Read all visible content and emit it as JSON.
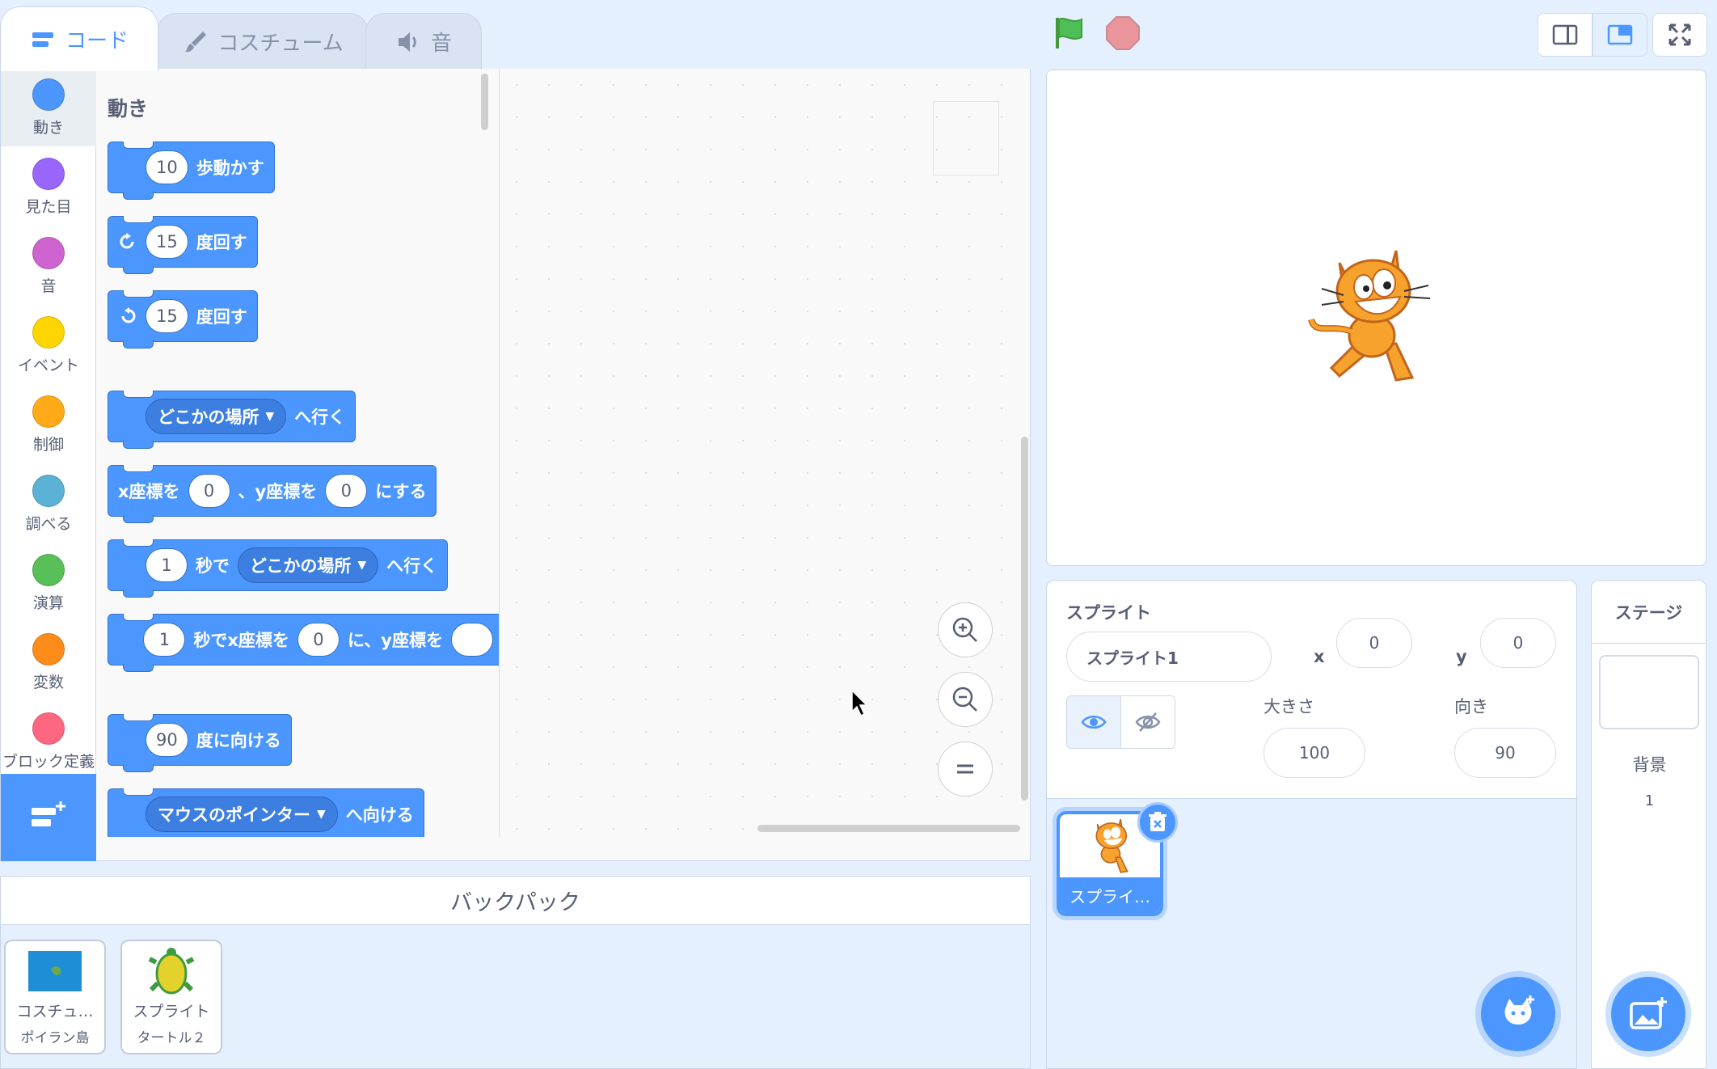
{
  "tabs": [
    {
      "label": "コード",
      "icon": "code-icon"
    },
    {
      "label": "コスチューム",
      "icon": "brush-icon"
    },
    {
      "label": "音",
      "icon": "speaker-icon"
    }
  ],
  "controls": {
    "green_flag": "green-flag-icon",
    "stop": "stop-icon"
  },
  "stage_modes": [
    "small-stage-icon",
    "normal-stage-icon",
    "fullscreen-icon"
  ],
  "categories": [
    {
      "label": "動き",
      "color": "#4c97ff"
    },
    {
      "label": "見た目",
      "color": "#9966ff"
    },
    {
      "label": "音",
      "color": "#cf63cf"
    },
    {
      "label": "イベント",
      "color": "#ffd500"
    },
    {
      "label": "制御",
      "color": "#ffab19"
    },
    {
      "label": "調べる",
      "color": "#5cb1d6"
    },
    {
      "label": "演算",
      "color": "#59c059"
    },
    {
      "label": "変数",
      "color": "#ff8c1a"
    },
    {
      "label": "ブロック定義",
      "color": "#ff6680"
    }
  ],
  "palette": {
    "section_title": "動き",
    "blocks": {
      "move": {
        "value": "10",
        "label": "歩動かす"
      },
      "turn_right": {
        "value": "15",
        "label": "度回す"
      },
      "turn_left": {
        "value": "15",
        "label": "度回す"
      },
      "goto": {
        "menu": "どこかの場所",
        "label": "へ行く"
      },
      "goto_xy": {
        "pre": "x座標を",
        "x": "0",
        "mid": "、y座標を",
        "y": "0",
        "post": "にする"
      },
      "glide": {
        "value": "1",
        "mid": "秒で",
        "menu": "どこかの場所",
        "label": "へ行く"
      },
      "glide_xy": {
        "value": "1",
        "mid": "秒でx座標を",
        "x": "0",
        "post": "に、y座標を"
      },
      "point_dir": {
        "value": "90",
        "label": "度に向ける"
      },
      "point_towards": {
        "menu": "マウスのポインター",
        "label": "へ向ける"
      }
    }
  },
  "backpack": {
    "title": "バックパック",
    "items": [
      {
        "title": "コスチュ…",
        "sub": "ポイラン島"
      },
      {
        "title": "スプライト",
        "sub": "タートル２"
      }
    ]
  },
  "sprite_info": {
    "heading": "スプライト",
    "name": "スプライト1",
    "x_label": "x",
    "x": "0",
    "y_label": "y",
    "y": "0",
    "size_label": "大きさ",
    "size": "100",
    "direction_label": "向き",
    "direction": "90"
  },
  "sprites": [
    {
      "name": "スプライ…"
    }
  ],
  "stage_pane": {
    "heading": "ステージ",
    "backdrop_label": "背景",
    "backdrop_count": "1"
  }
}
